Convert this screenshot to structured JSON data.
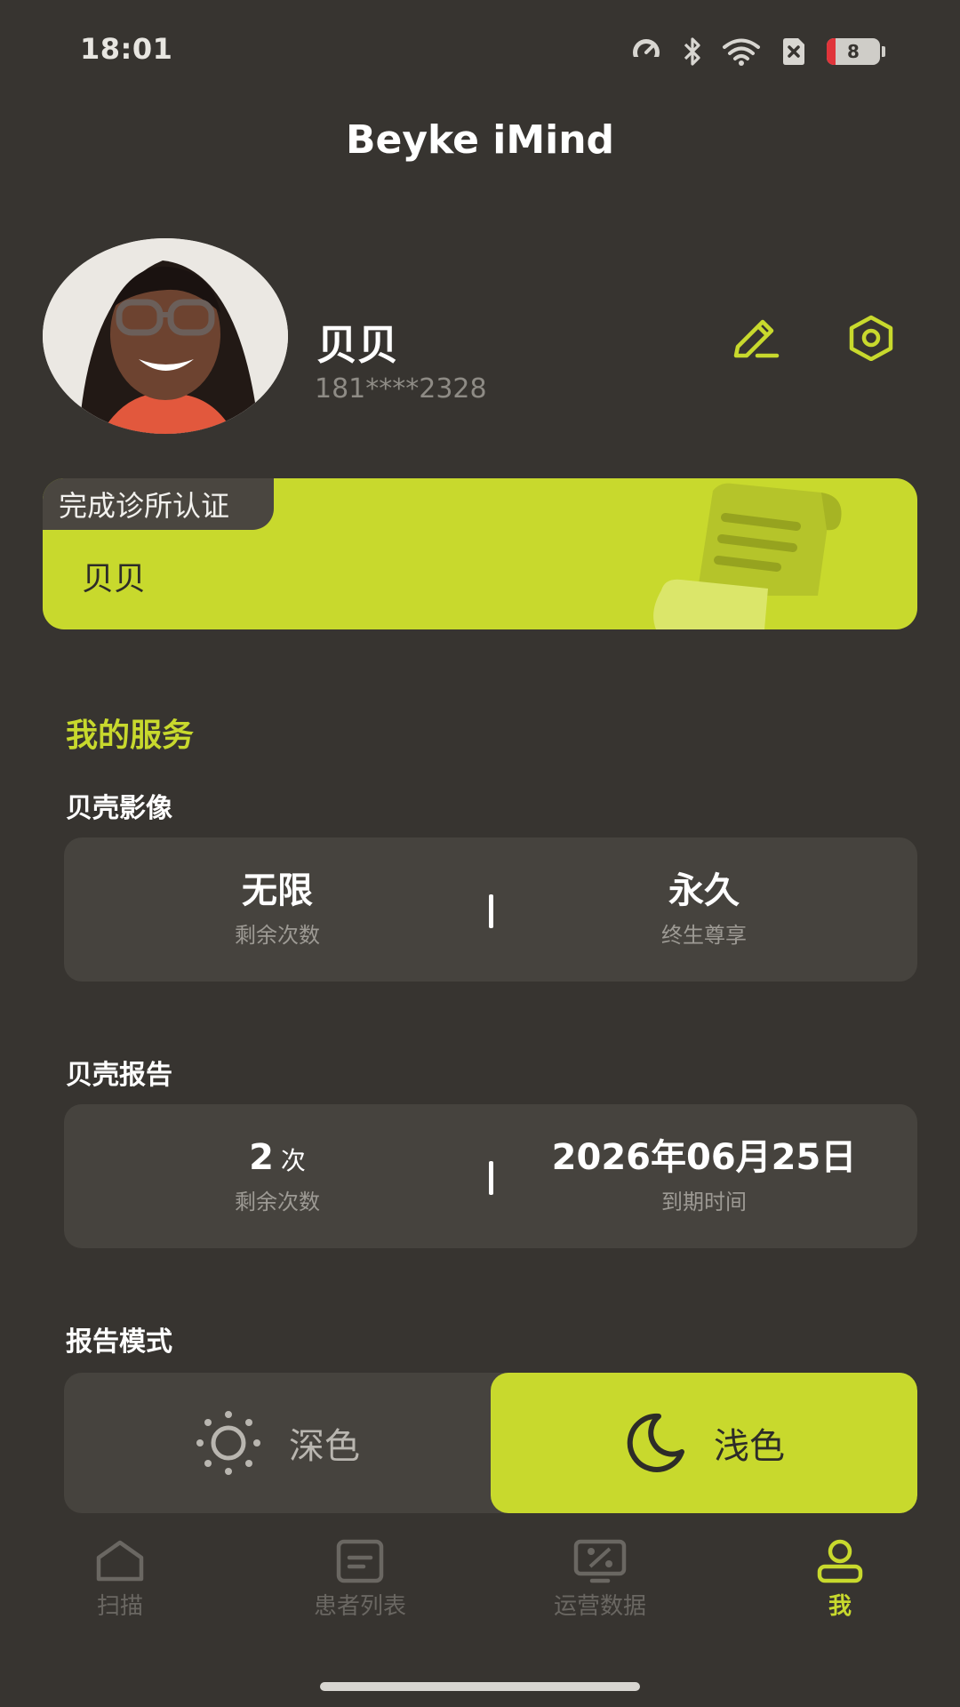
{
  "status_bar": {
    "time": "18:01",
    "battery": "8",
    "icons": [
      "speedometer-icon",
      "bluetooth-icon",
      "wifi-icon",
      "no-sim-icon",
      "battery-icon"
    ]
  },
  "app": {
    "title": "Beyke iMind"
  },
  "profile": {
    "name": "贝贝",
    "phone": "181****2328",
    "avatar_icon": "avatar-photo",
    "edit_icon": "edit-pencil-icon",
    "settings_icon": "hexagon-settings-icon"
  },
  "certification": {
    "tag": "完成诊所认证",
    "name": "贝贝",
    "illustration_icon": "scroll-document-icon"
  },
  "services": {
    "title": "我的服务",
    "imaging": {
      "title": "贝壳影像",
      "left_value": "无限",
      "left_label": "剩余次数",
      "right_value": "永久",
      "right_label": "终生尊享"
    },
    "report": {
      "title": "贝壳报告",
      "left_value": "2",
      "left_unit": "次",
      "left_label": "剩余次数",
      "right_value": "2026年06月25日",
      "right_label": "到期时间"
    }
  },
  "report_mode": {
    "title": "报告模式",
    "dark_label": "深色",
    "light_label": "浅色",
    "selected": "浅色"
  },
  "tabbar": {
    "items": [
      {
        "label": "扫描",
        "icon": "house-scan-icon"
      },
      {
        "label": "患者列表",
        "icon": "list-card-icon"
      },
      {
        "label": "运营数据",
        "icon": "percent-monitor-icon"
      },
      {
        "label": "我",
        "icon": "person-icon"
      }
    ],
    "active": "我"
  },
  "colors": {
    "background": "#373430",
    "accent": "#c8d92d",
    "card": "#46433e",
    "muted_text": "#9d9a94"
  }
}
